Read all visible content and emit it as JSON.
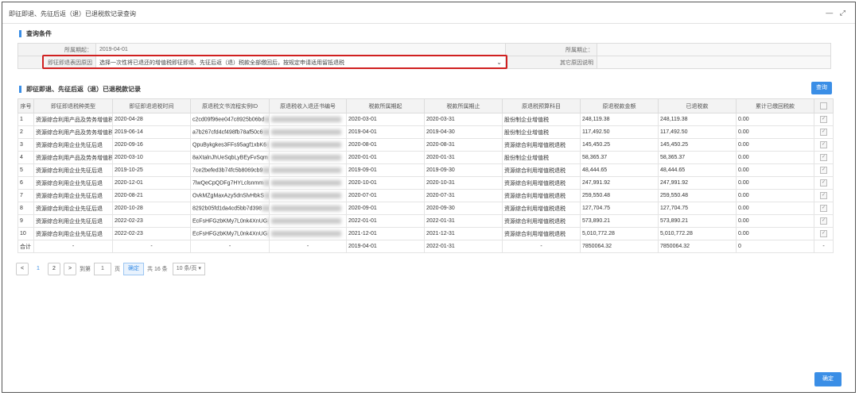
{
  "window": {
    "title": "即征即退、先征后返（退）已退税款记录查询",
    "minimize_glyph": "—",
    "maximize_glyph": "⤢"
  },
  "query": {
    "section_title": "查询条件",
    "period_start_label": "所属期起：",
    "period_start_value": "2019-04-01",
    "period_end_label": "所属期止：",
    "period_end_value": "",
    "reason_label": "即征即退表因原因",
    "reason_value": "选择一次性将已退还的增值税即征即退、先征后返（退）税款全部缴回后，按规定申请适用留抵退税",
    "other_reason_label": "其它原因说明",
    "other_reason_value": ""
  },
  "records": {
    "section_title": "即征即退、先征后返（退）已退税款记录",
    "query_button": "查询",
    "columns": [
      "序号",
      "即征即退税种类型",
      "即征即退退税时间",
      "原退税文书流程实例ID",
      "原退税收入退还书编号",
      "税款所属期起",
      "税款所属期止",
      "原退税预算科目",
      "原退税款金额",
      "已退税款",
      "累计已缴回税款"
    ],
    "rows": [
      {
        "no": "1",
        "type": "资源综合利用产品及劳务增值税",
        "time": "2020-04-28",
        "doc_id": "c2cd09f96ee047c8925b06bd",
        "start": "2020-03-01",
        "end": "2020-03-31",
        "subject": "股份制企业增值税",
        "amount": "248,119.38",
        "refunded": "248,119.38",
        "repaid": "0.00"
      },
      {
        "no": "2",
        "type": "资源综合利用产品及劳务增值税",
        "time": "2019-06-14",
        "doc_id": "a7b267cfd4cf498fb78af50c6",
        "start": "2019-04-01",
        "end": "2019-04-30",
        "subject": "股份制企业增值税",
        "amount": "117,492.50",
        "refunded": "117,492.50",
        "repaid": "0.00"
      },
      {
        "no": "3",
        "type": "资源综合利用企业先征后退",
        "time": "2020-09-16",
        "doc_id": "QpuBykgkes3FFs95agf1xbK6",
        "start": "2020-08-01",
        "end": "2020-08-31",
        "subject": "资源综合利用增值税退税",
        "amount": "145,450.25",
        "refunded": "145,450.25",
        "repaid": "0.00"
      },
      {
        "no": "4",
        "type": "资源综合利用产品及劳务增值税",
        "time": "2020-03-10",
        "doc_id": "8aXtalnJhUeSqbLyBEyFvSqm",
        "start": "2020-01-01",
        "end": "2020-01-31",
        "subject": "股份制企业增值税",
        "amount": "58,365.37",
        "refunded": "58,365.37",
        "repaid": "0.00"
      },
      {
        "no": "5",
        "type": "资源综合利用企业先征后退",
        "time": "2019-10-25",
        "doc_id": "7ce2befed3b74fc5b8069cb9",
        "start": "2019-09-01",
        "end": "2019-09-30",
        "subject": "资源综合利用增值税退税",
        "amount": "48,444.65",
        "refunded": "48,444.65",
        "repaid": "0.00"
      },
      {
        "no": "6",
        "type": "资源综合利用企业先征后退",
        "time": "2020-12-01",
        "doc_id": "7lwQeCpQDFg7HYLclsnmm",
        "start": "2020-10-01",
        "end": "2020-10-31",
        "subject": "资源综合利用增值税退税",
        "amount": "247,991.92",
        "refunded": "247,991.92",
        "repaid": "0.00"
      },
      {
        "no": "7",
        "type": "资源综合利用企业先征后退",
        "time": "2020-08-21",
        "doc_id": "OvkMZgMaxAzy5dnSlvHbkS",
        "start": "2020-07-01",
        "end": "2020-07-31",
        "subject": "资源综合利用增值税退税",
        "amount": "259,550.48",
        "refunded": "259,550.48",
        "repaid": "0.00"
      },
      {
        "no": "8",
        "type": "资源综合利用企业先征后退",
        "time": "2020-10-28",
        "doc_id": "8292b05fd1da4cd5bb7d398",
        "start": "2020-09-01",
        "end": "2020-09-30",
        "subject": "资源综合利用增值税退税",
        "amount": "127,704.75",
        "refunded": "127,704.75",
        "repaid": "0.00"
      },
      {
        "no": "9",
        "type": "资源综合利用企业先征后退",
        "time": "2022-02-23",
        "doc_id": "EcFsHFGzbKMy7L0nk4XnUG",
        "start": "2022-01-01",
        "end": "2022-01-31",
        "subject": "资源综合利用增值税退税",
        "amount": "573,890.21",
        "refunded": "573,890.21",
        "repaid": "0.00"
      },
      {
        "no": "10",
        "type": "资源综合利用企业先征后退",
        "time": "2022-02-23",
        "doc_id": "EcFsHFGzbKMy7L0nk4XnUG",
        "start": "2021-12-01",
        "end": "2021-12-31",
        "subject": "资源综合利用增值税退税",
        "amount": "5,010,772.28",
        "refunded": "5,010,772.28",
        "repaid": "0.00"
      }
    ],
    "total": {
      "label": "合计",
      "dash": "-",
      "start": "2019-04-01",
      "end": "2022-01-31",
      "amount": "7850064.32",
      "refunded": "7850064.32",
      "repaid": "0"
    }
  },
  "pager": {
    "prev": "<",
    "page1": "1",
    "page2": "2",
    "next": ">",
    "goto_label": "到第",
    "goto_value": "1",
    "page_unit": "页",
    "ok": "确定",
    "total": "共 16 条",
    "page_size": "10 条/页"
  },
  "footer": {
    "confirm": "确定"
  }
}
